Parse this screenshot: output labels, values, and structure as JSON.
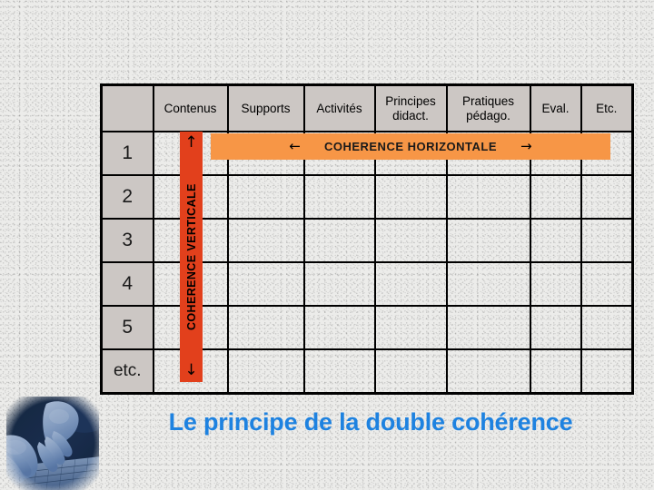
{
  "slide": {
    "title": "Le principe de la double cohérence",
    "title_color": "#1e82e0",
    "background_color": "#ececea"
  },
  "table": {
    "corner_label": "",
    "headers": [
      {
        "line1": "Contenus",
        "line2": ""
      },
      {
        "line1": "Supports",
        "line2": ""
      },
      {
        "line1": "Activités",
        "line2": ""
      },
      {
        "line1": "Principes",
        "line2": "didact."
      },
      {
        "line1": "Pratiques",
        "line2": "pédago."
      },
      {
        "line1": "Eval.",
        "line2": ""
      },
      {
        "line1": "Etc.",
        "line2": ""
      }
    ],
    "row_labels": [
      "1",
      "2",
      "3",
      "4",
      "5",
      "etc."
    ],
    "header_bg": "#ccc7c4",
    "border_color": "#000000"
  },
  "vertical_axis": {
    "label": "COHERENCE VERTICALE",
    "arrow_top": "↑",
    "arrow_bottom": "↓",
    "color": "#e2401c"
  },
  "horizontal_axis": {
    "label": "COHERENCE HORIZONTALE",
    "arrow_left": "←",
    "arrow_right": "→",
    "color": "#f79646"
  },
  "photo": {
    "name": "hands-typing-on-laptop-keyboard",
    "tint": "#5a7fb0"
  }
}
